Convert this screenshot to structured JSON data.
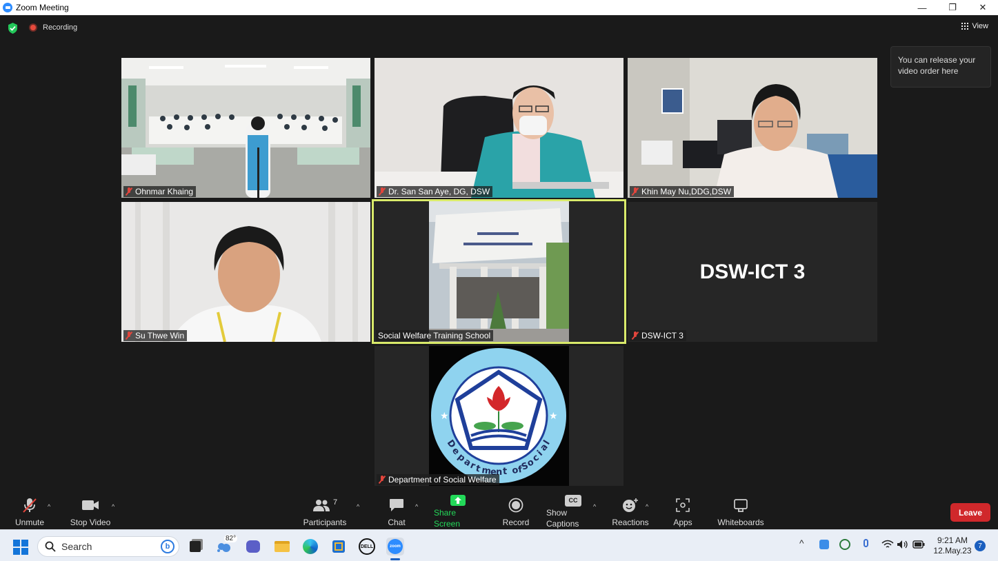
{
  "window": {
    "title": "Zoom Meeting",
    "minimize": "—",
    "restore": "❐",
    "close": "✕"
  },
  "topbar": {
    "recording_label": "Recording",
    "view_label": "View",
    "tooltip": "You can release your video order here"
  },
  "tiles": [
    {
      "name": "Ohnmar Khaing",
      "muted": true
    },
    {
      "name": "Dr. San San Aye, DG, DSW",
      "muted": true
    },
    {
      "name": "Khin May Nu,DDG,DSW",
      "muted": true
    },
    {
      "name": "Su Thwe Win",
      "muted": true
    },
    {
      "name": "Social Welfare Training School",
      "muted": false,
      "active_speaker": true
    },
    {
      "name": "DSW-ICT 3",
      "muted": true,
      "display_text": "DSW-ICT 3"
    },
    {
      "name": "Department of Social Welfare",
      "muted": true
    }
  ],
  "toolbar": {
    "unmute": "Unmute",
    "stop_video": "Stop Video",
    "participants": "Participants",
    "participants_count": "7",
    "chat": "Chat",
    "share_screen": "Share Screen",
    "record": "Record",
    "show_captions": "Show Captions",
    "cc": "CC",
    "reactions": "Reactions",
    "apps": "Apps",
    "whiteboards": "Whiteboards",
    "leave": "Leave"
  },
  "taskbar": {
    "search_label": "Search",
    "weather_temp": "82°",
    "time": "9:21 AM",
    "date": "12.May.23",
    "notification_count": "7",
    "dell_label": "DELL",
    "zoom_label": "zoom"
  },
  "colors": {
    "accent_green": "#23d959",
    "leave_red": "#d0282b",
    "active_border": "#d9ea6a",
    "mute_red": "#e2453c",
    "zoom_blue": "#2d8cff"
  }
}
